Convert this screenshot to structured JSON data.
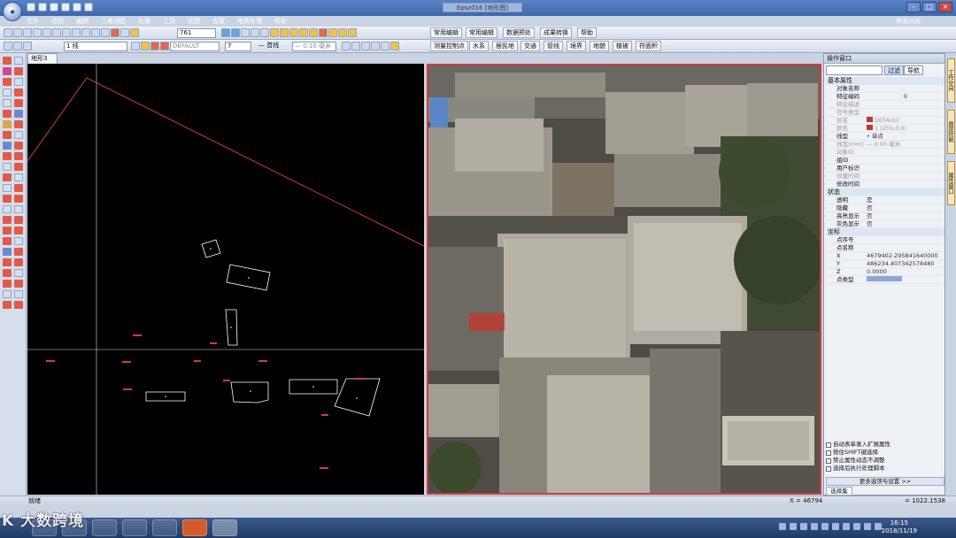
{
  "window": {
    "title": "Epsz016 [地形图]",
    "skin_label": "界面风格"
  },
  "menu": [
    "文件",
    "绘图",
    "编辑",
    "三维测图",
    "处理",
    "工具",
    "视图",
    "设置",
    "地质处理",
    "帮助"
  ],
  "toolbar1": {
    "zoom_value": "761",
    "tabs": [
      "常用编辑",
      "常用编辑",
      "数据预处",
      "成果转换",
      "帮助"
    ]
  },
  "toolbar2": {
    "line_code": "1 线",
    "layer_value": "DEFAULT",
    "color_value": "7",
    "linetype_label": "— 首线",
    "linewidth_value": "— 0.10 毫米",
    "tabs": [
      "测量控制点",
      "水系",
      "居民地",
      "交通",
      "管线",
      "境界",
      "地貌",
      "植被",
      "符面积"
    ]
  },
  "doc_tab": "地形3",
  "props": {
    "title": "操作窗口",
    "filter_opts": [
      "过滤",
      "导航"
    ],
    "sections": [
      {
        "name": "基本属性",
        "rows": [
          {
            "k": "对象名称",
            "v": "",
            "dim": false
          },
          {
            "k": "特征编码",
            "v": "0",
            "dim": false
          },
          {
            "k": "特征描述",
            "v": "",
            "dim": true
          },
          {
            "k": "符号类型",
            "v": "",
            "dim": true
          },
          {
            "k": "层名",
            "v": "DEFAULT",
            "dim": true
          },
          {
            "k": "颜色",
            "v": "1 (255,0,0)",
            "dim": true
          },
          {
            "k": "线型",
            "v": "• 单点",
            "dim": false
          },
          {
            "k": "线宽(mm)",
            "v": "— 0.00 毫米",
            "dim": true
          },
          {
            "k": "对象ID",
            "v": "",
            "dim": true
          },
          {
            "k": "组ID",
            "v": "",
            "dim": false
          },
          {
            "k": "用户标识",
            "v": "",
            "dim": false
          },
          {
            "k": "创建时间",
            "v": "",
            "dim": true
          },
          {
            "k": "修改时间",
            "v": "",
            "dim": false
          }
        ]
      },
      {
        "name": "状态",
        "rows": [
          {
            "k": "透明",
            "v": "是",
            "dim": false
          },
          {
            "k": "隐藏",
            "v": "否",
            "dim": false
          },
          {
            "k": "高亮显示",
            "v": "否",
            "dim": false
          },
          {
            "k": "灰色显示",
            "v": "否",
            "dim": false
          }
        ]
      },
      {
        "name": "坐标",
        "rows": [
          {
            "k": "点序号",
            "v": "",
            "dim": false
          },
          {
            "k": "点名称",
            "v": "",
            "dim": false
          },
          {
            "k": "X",
            "v": "4679402.295841640000",
            "dim": false
          },
          {
            "k": "Y",
            "v": "486234.407342578480",
            "dim": false
          },
          {
            "k": "Z",
            "v": "0.0000",
            "dim": false
          },
          {
            "k": "点类型",
            "v": "",
            "dim": false
          }
        ]
      }
    ],
    "checks": [
      "自动表单录入扩展属性",
      "按住SHIFT键选择",
      "禁止属性动态不调整",
      "选择后执行处理脚本"
    ],
    "more_button": "更多选项与设置 >>",
    "panel_tab": "选择集"
  },
  "right_tabs": [
    "工作空间",
    "图层控制",
    "属性窗口"
  ],
  "status": {
    "left": "就绪",
    "coords": "X = 46794",
    "coords_right": "= 1022.1538"
  },
  "clock": {
    "time": "16:15",
    "date": "2018/11/19"
  },
  "watermark": "K 大数跨境",
  "colors": {
    "accent": "#3f67ab",
    "frame_red": "#d23b3b",
    "cad_bg": "#000000"
  }
}
